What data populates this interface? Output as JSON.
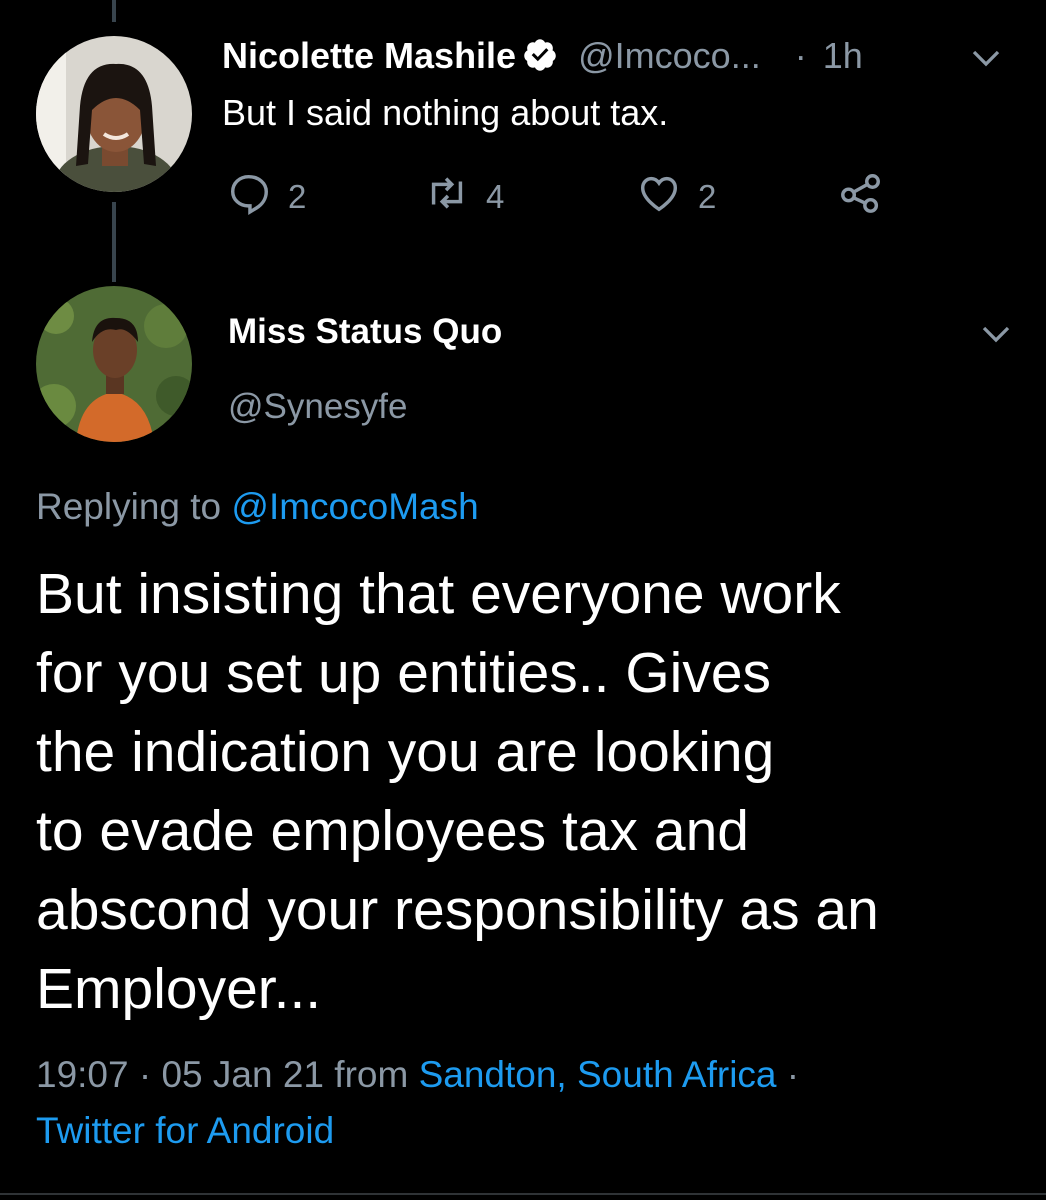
{
  "parent_tweet": {
    "display_name": "Nicolette Mashile",
    "handle": "@Imcoco...",
    "time_separator": "·",
    "time": "1h",
    "text": "But I said nothing about tax.",
    "actions": {
      "replies": "2",
      "retweets": "4",
      "likes": "2"
    }
  },
  "main_tweet": {
    "display_name": "Miss Status Quo",
    "handle": "@Synesyfe",
    "replying_prefix": "Replying to",
    "replying_to": "@ImcocoMash",
    "text": "But insisting that everyone work\nfor you set up entities.. Gives\nthe indication you are looking\nto evade employees tax and\nabscond your responsibility as an\nEmployer...",
    "meta": {
      "time": "19:07",
      "sep1": "·",
      "date": "05 Jan 21",
      "from_label": "from",
      "location": "Sandton, South Africa",
      "sep2": "·",
      "source": "Twitter for Android"
    }
  },
  "colors": {
    "background": "#000000",
    "text": "#ffffff",
    "muted": "#8b98a5",
    "link": "#1d9bf0",
    "thread_line": "#38444d"
  }
}
